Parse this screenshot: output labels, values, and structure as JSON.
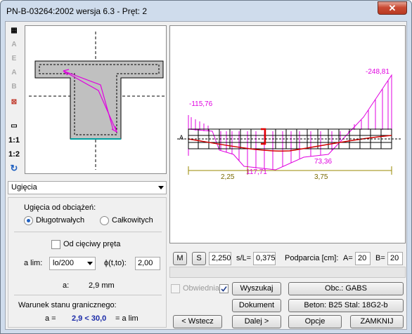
{
  "window": {
    "title": "PN-B-03264:2002 wersja 6.3 - Pręt: 2",
    "close_glyph": "✕"
  },
  "toolbar": {
    "items": [
      {
        "name": "ruler-icon",
        "glyph": "▦"
      },
      {
        "name": "rebar-a-icon",
        "glyph": "A"
      },
      {
        "name": "rebar-e-icon",
        "glyph": "E"
      },
      {
        "name": "rebar-a2-icon",
        "glyph": "A"
      },
      {
        "name": "rebar-b-icon",
        "glyph": "B"
      },
      {
        "name": "delete-icon",
        "glyph": "⊠"
      },
      {
        "name": "scale-icon",
        "glyph": "▭"
      },
      {
        "name": "scale-1-1-icon",
        "glyph": "1:1"
      },
      {
        "name": "scale-1-2-icon",
        "glyph": "1:2"
      },
      {
        "name": "rotate-icon",
        "glyph": "↻"
      }
    ]
  },
  "chart": {
    "left_top_value": "-115,76",
    "right_top_value": "-248,81",
    "mid_bottom_value": "117,71",
    "right_bottom_value": "73,36",
    "support_label": "A",
    "span_left": "2,25",
    "span_right": "3,75"
  },
  "mode_select": {
    "value": "Ugięcia"
  },
  "options": {
    "group_label": "Ugięcia od obciążeń:",
    "radio_long": "Długotrwałych",
    "radio_total": "Całkowitych",
    "chord_checkbox": "Od cięciwy pręta",
    "alim_label": "a lim:",
    "alim_value": "lo/200",
    "phi_label": "ϕ(t,to):",
    "phi_value": "2,00",
    "a_label": "a:",
    "a_value": "2,9 mm",
    "limit_title": "Warunek stanu granicznego:",
    "limit_a": "a  =",
    "limit_expr": "2,9 < 30,0",
    "limit_alim": "= a lim"
  },
  "bottom": {
    "m_label": "M",
    "s_label": "S",
    "s_value": "2,250",
    "sL_label": "s/L=",
    "sL_value": "0,375",
    "supports_label": "Podparcia [cm]:",
    "a_eq": "A=",
    "a_val": "20",
    "b_eq": "B=",
    "b_val": "20",
    "envelope_label": "Obwiednia",
    "find_button": "Wyszukaj",
    "loads_button": "Obc.: GABS",
    "document_button": "Dokument",
    "concrete_button": "Beton: B25   Stal: 18G2-b",
    "back_button": "< Wstecz",
    "next_button": "Dalej >",
    "options_button": "Opcje",
    "close_button": "ZAMKNIJ"
  }
}
